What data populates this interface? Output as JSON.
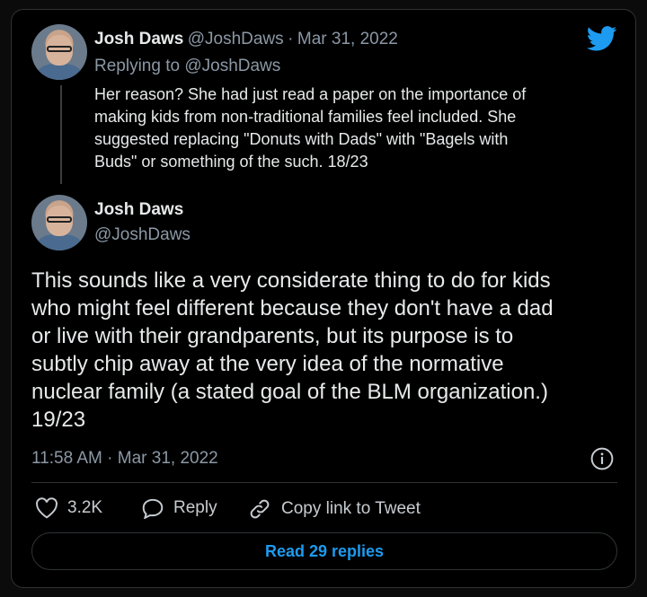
{
  "reply_tweet": {
    "display_name": "Josh Daws",
    "handle": "@JoshDaws",
    "date": "Mar 31, 2022",
    "replying_to": "Replying to @JoshDaws",
    "text_lines": [
      "Her reason? She had just read a paper on the importance of",
      "making kids from non-traditional families feel included. She",
      "suggested replacing \"Donuts with Dads\" with \"Bagels with",
      "Buds\" or something of the such. 18/23"
    ]
  },
  "main_tweet": {
    "display_name": "Josh Daws",
    "handle": "@JoshDaws",
    "text_lines": [
      "This sounds like a very considerate thing to do for kids",
      "who might feel different because they don't have a dad",
      "or live with their grandparents, but its purpose is to",
      "subtly chip away at the very idea of the normative",
      "nuclear family (a stated goal of the BLM organization.)",
      "19/23"
    ],
    "timestamp": "11:58 AM · Mar 31, 2022"
  },
  "actions": {
    "likes": "3.2K",
    "reply_label": "Reply",
    "copy_link_label": "Copy link to Tweet"
  },
  "read_replies_label": "Read 29 replies",
  "colors": {
    "accent": "#1d9bf0",
    "background": "#000000",
    "secondary_text": "#8b98a5"
  },
  "icons": [
    "twitter-bird-icon",
    "info-icon",
    "heart-icon",
    "reply-icon",
    "link-icon"
  ]
}
